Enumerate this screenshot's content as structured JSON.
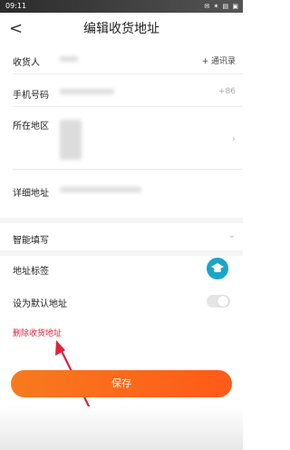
{
  "status": {
    "time": "09:11",
    "icons": "✉ ✶ ▤ ▣"
  },
  "header": {
    "back_label": "<",
    "title": "编辑收货地址"
  },
  "form": {
    "receiver_label": "收货人",
    "contacts_label": "+ 通讯录",
    "phone_label": "手机号码",
    "phone_prefix": "+86",
    "region_label": "所在地区",
    "detail_label": "详细地址",
    "smart_fill_label": "智能填写",
    "tag_label": "地址标签",
    "default_label": "设为默认地址",
    "delete_label": "删除收货地址",
    "save_label": "保存"
  },
  "icons": {
    "back": "chevron-left-icon",
    "region_chevron": "chevron-right-icon",
    "smart_chevron": "chevron-down-icon",
    "tag": "graduation-cap-icon"
  },
  "colors": {
    "accent": "#ff6a1a",
    "delete": "#e0243a",
    "tag": "#1aa6c6"
  }
}
